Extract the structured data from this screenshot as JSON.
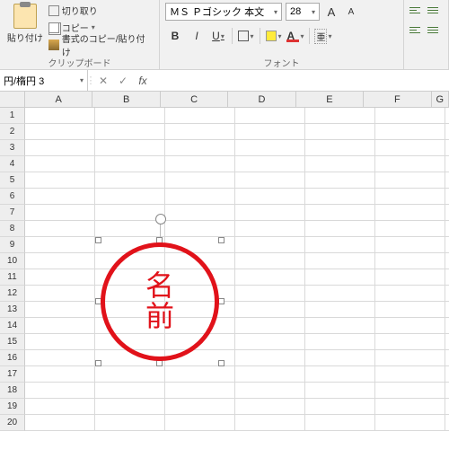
{
  "ribbon": {
    "clipboard": {
      "paste_label": "貼り付け",
      "cut_label": "切り取り",
      "copy_label": "コピー",
      "format_painter_label": "書式のコピー/貼り付け",
      "group_label": "クリップボード"
    },
    "font": {
      "font_name": "ＭＳ Ｐゴシック 本文",
      "font_size": "28",
      "increase_font": "A",
      "decrease_font": "A",
      "bold": "B",
      "italic": "I",
      "underline": "U",
      "ruby": "亜",
      "font_color_letter": "A",
      "group_label": "フォント"
    }
  },
  "namebox": {
    "value": "円/楕円 3"
  },
  "formula_bar": {
    "cancel": "✕",
    "enter": "✓",
    "fx": "fx",
    "value": ""
  },
  "grid": {
    "columns": [
      "A",
      "B",
      "C",
      "D",
      "E",
      "F",
      "G"
    ],
    "rows": [
      "1",
      "2",
      "3",
      "4",
      "5",
      "6",
      "7",
      "8",
      "9",
      "10",
      "11",
      "12",
      "13",
      "14",
      "15",
      "16",
      "17",
      "18",
      "19",
      "20"
    ]
  },
  "shape": {
    "text_line1": "名",
    "text_line2": "前"
  }
}
